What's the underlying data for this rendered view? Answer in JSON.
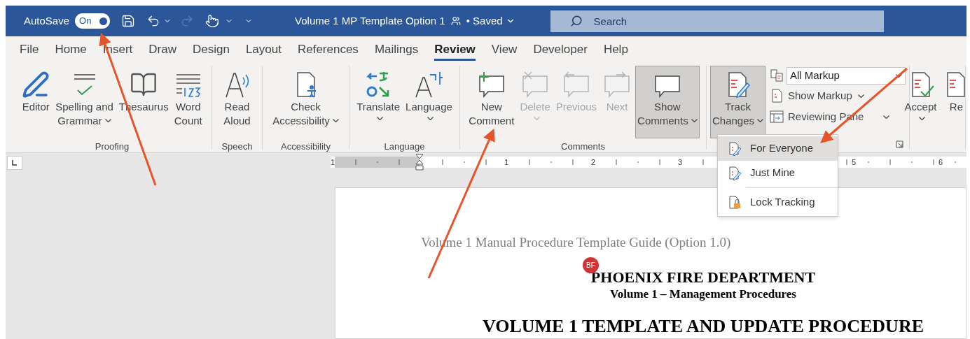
{
  "title_bar": {
    "autosave": {
      "label": "AutoSave",
      "on": true,
      "state_text": "On"
    },
    "document_title": "Volume 1 MP Template Option 1",
    "save_status": "• Saved",
    "search": {
      "placeholder": "Search"
    }
  },
  "tabs": [
    {
      "label": "File",
      "selected": false
    },
    {
      "label": "Home",
      "selected": false
    },
    {
      "label": "Insert",
      "selected": false
    },
    {
      "label": "Draw",
      "selected": false
    },
    {
      "label": "Design",
      "selected": false
    },
    {
      "label": "Layout",
      "selected": false
    },
    {
      "label": "References",
      "selected": false
    },
    {
      "label": "Mailings",
      "selected": false
    },
    {
      "label": "Review",
      "selected": true
    },
    {
      "label": "View",
      "selected": false
    },
    {
      "label": "Developer",
      "selected": false
    },
    {
      "label": "Help",
      "selected": false
    }
  ],
  "ribbon": {
    "groups": [
      {
        "label": "Proofing",
        "buttons": [
          {
            "lines": [
              "Editor"
            ],
            "dropdown": false,
            "disabled": false,
            "pressed": false
          },
          {
            "lines": [
              "Spelling and",
              "Grammar"
            ],
            "dropdown": true,
            "disabled": false,
            "pressed": false
          },
          {
            "lines": [
              "Thesaurus"
            ],
            "dropdown": false,
            "disabled": false,
            "pressed": false
          },
          {
            "lines": [
              "Word",
              "Count"
            ],
            "dropdown": false,
            "disabled": false,
            "pressed": false
          }
        ]
      },
      {
        "label": "Speech",
        "buttons": [
          {
            "lines": [
              "Read",
              "Aloud"
            ],
            "dropdown": false,
            "disabled": false,
            "pressed": false
          }
        ]
      },
      {
        "label": "Accessibility",
        "buttons": [
          {
            "lines": [
              "Check",
              "Accessibility"
            ],
            "dropdown": true,
            "disabled": false,
            "pressed": false
          }
        ]
      },
      {
        "label": "Language",
        "buttons": [
          {
            "lines": [
              "Translate"
            ],
            "dropdown": true,
            "disabled": false,
            "pressed": false
          },
          {
            "lines": [
              "Language"
            ],
            "dropdown": true,
            "disabled": false,
            "pressed": false
          }
        ]
      },
      {
        "label": "Comments",
        "buttons": [
          {
            "lines": [
              "New",
              "Comment"
            ],
            "dropdown": false,
            "disabled": false,
            "pressed": false
          },
          {
            "lines": [
              "Delete"
            ],
            "dropdown": true,
            "disabled": true,
            "pressed": false
          },
          {
            "lines": [
              "Previous"
            ],
            "dropdown": false,
            "disabled": true,
            "pressed": false
          },
          {
            "lines": [
              "Next"
            ],
            "dropdown": false,
            "disabled": true,
            "pressed": false
          },
          {
            "lines": [
              "Show",
              "Comments"
            ],
            "dropdown": true,
            "disabled": false,
            "pressed": true
          }
        ]
      },
      {
        "buttons": [
          {
            "lines": [
              "Track",
              "Changes"
            ],
            "dropdown": true,
            "disabled": false,
            "pressed": true
          }
        ],
        "options": [
          {
            "kind": "select",
            "value": "All Markup"
          },
          {
            "kind": "command",
            "label": "Show Markup",
            "dropdown": true
          },
          {
            "kind": "command",
            "label": "Reviewing Pane",
            "dropdown": true
          }
        ]
      },
      {
        "buttons": [
          {
            "lines": [
              "Accept"
            ],
            "dropdown": true,
            "disabled": false,
            "pressed": false
          },
          {
            "lines": [
              "Re"
            ],
            "dropdown": false,
            "disabled": false,
            "pressed": false
          }
        ]
      }
    ]
  },
  "ruler": {
    "labels": [
      "1",
      "1",
      "2",
      "3",
      "5",
      "6"
    ]
  },
  "document": {
    "header": "Volume 1 Manual Procedure Template Guide (Option 1.0)",
    "comment_marker": "BF",
    "title": "PHOENIX FIRE DEPARTMENT",
    "subtitle": "Volume 1 – Management Procedures",
    "heading": "VOLUME 1 TEMPLATE AND UPDATE PROCEDURE"
  },
  "track_changes_menu": {
    "items": [
      {
        "label": "For Everyone",
        "selected": true
      },
      {
        "label": "Just Mine",
        "selected": false
      },
      {
        "label": "Lock Tracking",
        "selected": false
      }
    ]
  }
}
